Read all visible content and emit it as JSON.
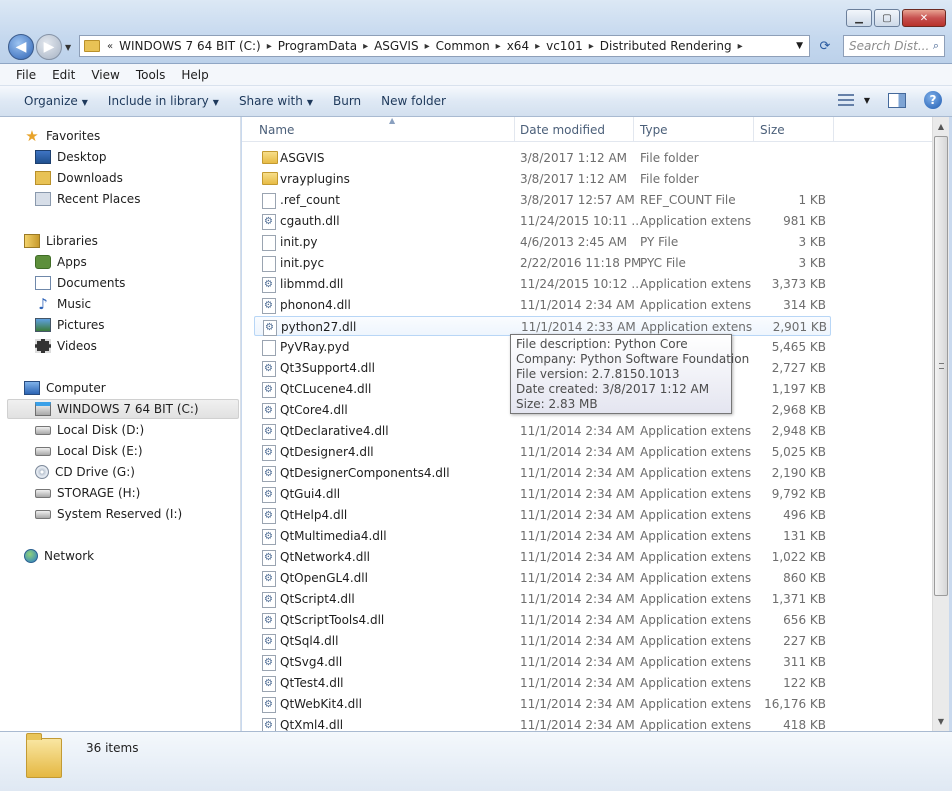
{
  "window": {
    "minimize_label": "▁",
    "maximize_label": "▢",
    "close_label": "✕"
  },
  "address": {
    "prefix": "«",
    "crumbs": [
      "WINDOWS 7 64 BIT (C:)",
      "ProgramData",
      "ASGVIS",
      "Common",
      "x64",
      "vc101",
      "Distributed Rendering"
    ],
    "separator": "▸",
    "dropdown": "▼",
    "refresh": "⟳"
  },
  "search": {
    "placeholder": "Search Dist...",
    "icon": "⌕"
  },
  "menu": [
    "File",
    "Edit",
    "View",
    "Tools",
    "Help"
  ],
  "commands": {
    "organize": "Organize",
    "include_in_library": "Include in library",
    "share_with": "Share with",
    "burn": "Burn",
    "new_folder": "New folder",
    "caret": "▼",
    "help": "?"
  },
  "nav": {
    "favorites": "Favorites",
    "desktop": "Desktop",
    "downloads": "Downloads",
    "recent": "Recent Places",
    "libraries": "Libraries",
    "apps": "Apps",
    "documents": "Documents",
    "music": "Music",
    "pictures": "Pictures",
    "videos": "Videos",
    "computer": "Computer",
    "drive_c": "WINDOWS 7 64 BIT (C:)",
    "drive_d": "Local Disk (D:)",
    "drive_e": "Local Disk (E:)",
    "drive_g": "CD Drive (G:)",
    "drive_h": "STORAGE (H:)",
    "drive_i": "System Reserved (I:)",
    "network": "Network"
  },
  "columns": {
    "name": "Name",
    "date": "Date modified",
    "type": "Type",
    "size": "Size"
  },
  "files": [
    {
      "name": "ASGVIS",
      "date": "3/8/2017 1:12 AM",
      "type": "File folder",
      "size": "",
      "icon": "folder"
    },
    {
      "name": "vrayplugins",
      "date": "3/8/2017 1:12 AM",
      "type": "File folder",
      "size": "",
      "icon": "folder"
    },
    {
      "name": ".ref_count",
      "date": "3/8/2017 12:57 AM",
      "type": "REF_COUNT File",
      "size": "1 KB",
      "icon": "file"
    },
    {
      "name": "cgauth.dll",
      "date": "11/24/2015 10:11 ...",
      "type": "Application extens...",
      "size": "981 KB",
      "icon": "dll"
    },
    {
      "name": "init.py",
      "date": "4/6/2013 2:45 AM",
      "type": "PY File",
      "size": "3 KB",
      "icon": "file"
    },
    {
      "name": "init.pyc",
      "date": "2/22/2016 11:18 PM",
      "type": "PYC File",
      "size": "3 KB",
      "icon": "file"
    },
    {
      "name": "libmmd.dll",
      "date": "11/24/2015 10:12 ...",
      "type": "Application extens...",
      "size": "3,373 KB",
      "icon": "dll"
    },
    {
      "name": "phonon4.dll",
      "date": "11/1/2014 2:34 AM",
      "type": "Application extens...",
      "size": "314 KB",
      "icon": "dll"
    },
    {
      "name": "python27.dll",
      "date": "11/1/2014 2:33 AM",
      "type": "Application extens...",
      "size": "2,901 KB",
      "icon": "dll"
    },
    {
      "name": "PyVRay.pyd",
      "date": "",
      "type": "",
      "size": "5,465 KB",
      "icon": "file"
    },
    {
      "name": "Qt3Support4.dll",
      "date": "",
      "type": "",
      "size": "2,727 KB",
      "icon": "dll"
    },
    {
      "name": "QtCLucene4.dll",
      "date": "",
      "type": "",
      "size": "1,197 KB",
      "icon": "dll"
    },
    {
      "name": "QtCore4.dll",
      "date": "",
      "type": "",
      "size": "2,968 KB",
      "icon": "dll"
    },
    {
      "name": "QtDeclarative4.dll",
      "date": "11/1/2014 2:34 AM",
      "type": "Application extens...",
      "size": "2,948 KB",
      "icon": "dll"
    },
    {
      "name": "QtDesigner4.dll",
      "date": "11/1/2014 2:34 AM",
      "type": "Application extens...",
      "size": "5,025 KB",
      "icon": "dll"
    },
    {
      "name": "QtDesignerComponents4.dll",
      "date": "11/1/2014 2:34 AM",
      "type": "Application extens...",
      "size": "2,190 KB",
      "icon": "dll"
    },
    {
      "name": "QtGui4.dll",
      "date": "11/1/2014 2:34 AM",
      "type": "Application extens...",
      "size": "9,792 KB",
      "icon": "dll"
    },
    {
      "name": "QtHelp4.dll",
      "date": "11/1/2014 2:34 AM",
      "type": "Application extens...",
      "size": "496 KB",
      "icon": "dll"
    },
    {
      "name": "QtMultimedia4.dll",
      "date": "11/1/2014 2:34 AM",
      "type": "Application extens...",
      "size": "131 KB",
      "icon": "dll"
    },
    {
      "name": "QtNetwork4.dll",
      "date": "11/1/2014 2:34 AM",
      "type": "Application extens...",
      "size": "1,022 KB",
      "icon": "dll"
    },
    {
      "name": "QtOpenGL4.dll",
      "date": "11/1/2014 2:34 AM",
      "type": "Application extens...",
      "size": "860 KB",
      "icon": "dll"
    },
    {
      "name": "QtScript4.dll",
      "date": "11/1/2014 2:34 AM",
      "type": "Application extens...",
      "size": "1,371 KB",
      "icon": "dll"
    },
    {
      "name": "QtScriptTools4.dll",
      "date": "11/1/2014 2:34 AM",
      "type": "Application extens...",
      "size": "656 KB",
      "icon": "dll"
    },
    {
      "name": "QtSql4.dll",
      "date": "11/1/2014 2:34 AM",
      "type": "Application extens...",
      "size": "227 KB",
      "icon": "dll"
    },
    {
      "name": "QtSvg4.dll",
      "date": "11/1/2014 2:34 AM",
      "type": "Application extens...",
      "size": "311 KB",
      "icon": "dll"
    },
    {
      "name": "QtTest4.dll",
      "date": "11/1/2014 2:34 AM",
      "type": "Application extens...",
      "size": "122 KB",
      "icon": "dll"
    },
    {
      "name": "QtWebKit4.dll",
      "date": "11/1/2014 2:34 AM",
      "type": "Application extens...",
      "size": "16,176 KB",
      "icon": "dll"
    },
    {
      "name": "QtXml4.dll",
      "date": "11/1/2014 2:34 AM",
      "type": "Application extens...",
      "size": "418 KB",
      "icon": "dll"
    }
  ],
  "hovered_index": 8,
  "tooltip": {
    "line1": "File description: Python Core",
    "line2": "Company: Python Software Foundation",
    "line3": "File version: 2.7.8150.1013",
    "line4": "Date created: 3/8/2017 1:12 AM",
    "line5": "Size: 2.83 MB"
  },
  "scrollbar": {
    "up": "▲",
    "down": "▼"
  },
  "status": {
    "items": "36 items"
  }
}
